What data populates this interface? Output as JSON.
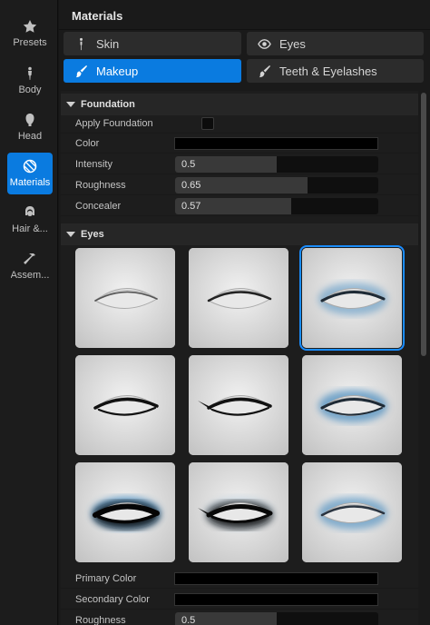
{
  "sidebar": {
    "items": [
      {
        "label": "Presets",
        "icon": "star-icon"
      },
      {
        "label": "Body",
        "icon": "person-icon"
      },
      {
        "label": "Head",
        "icon": "head-icon"
      },
      {
        "label": "Materials",
        "icon": "materials-icon",
        "active": true
      },
      {
        "label": "Hair &...",
        "icon": "hair-icon"
      },
      {
        "label": "Assem...",
        "icon": "hammer-icon"
      }
    ]
  },
  "panel": {
    "title": "Materials"
  },
  "tabs": [
    {
      "label": "Skin",
      "icon": "figure-icon"
    },
    {
      "label": "Eyes",
      "icon": "eye-icon"
    },
    {
      "label": "Makeup",
      "icon": "brush-icon",
      "active": true
    },
    {
      "label": "Teeth & Eyelashes",
      "icon": "brush-icon"
    }
  ],
  "foundation": {
    "title": "Foundation",
    "apply_label": "Apply Foundation",
    "apply_checked": false,
    "color_label": "Color",
    "color_value": "#000000",
    "intensity": {
      "label": "Intensity",
      "value": "0.5",
      "fraction": 0.5
    },
    "roughness": {
      "label": "Roughness",
      "value": "0.65",
      "fraction": 0.65
    },
    "concealer": {
      "label": "Concealer",
      "value": "0.57",
      "fraction": 0.57
    }
  },
  "eyes": {
    "title": "Eyes",
    "presets": [
      {
        "style": "none",
        "selected": false
      },
      {
        "style": "thin-liner",
        "selected": false
      },
      {
        "style": "blue-liner",
        "selected": true
      },
      {
        "style": "liner-lower",
        "selected": false
      },
      {
        "style": "wing",
        "selected": false
      },
      {
        "style": "blue-shadow",
        "selected": false
      },
      {
        "style": "smoky-blue",
        "selected": false
      },
      {
        "style": "dramatic-wing",
        "selected": false
      },
      {
        "style": "soft-blue",
        "selected": false
      }
    ],
    "primary_color_label": "Primary Color",
    "secondary_color_label": "Secondary Color",
    "roughness": {
      "label": "Roughness",
      "value": "0.5",
      "fraction": 0.5
    }
  },
  "colors": {
    "accent": "#0a7be0",
    "selection": "#1a8cff",
    "eye_blue": "#4f8fbf"
  }
}
